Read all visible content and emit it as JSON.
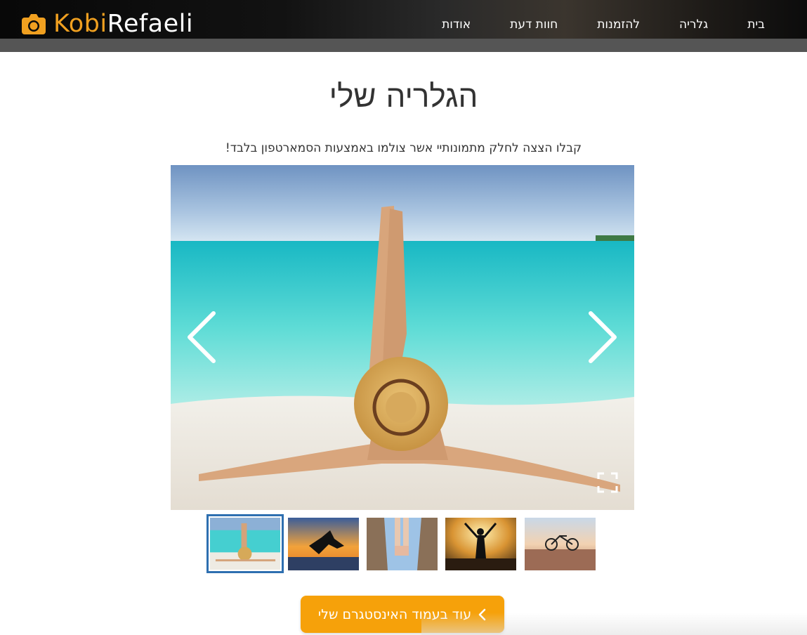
{
  "brand": {
    "name_part1": "Kobi",
    "name_part2": "Refaeli",
    "icon": "camera-icon"
  },
  "nav": {
    "items": [
      {
        "label": "בית"
      },
      {
        "label": "גלריה"
      },
      {
        "label": "להזמנות"
      },
      {
        "label": "חוות דעת"
      },
      {
        "label": "אודות"
      }
    ]
  },
  "gallery": {
    "title": "הגלריה שלי",
    "subtitle": "קבלו הצצה לחלק מתמונותיי אשר צולמו באמצעות הסמארטפון בלבד!",
    "prev_icon": "chevron-left-icon",
    "next_icon": "chevron-right-icon",
    "fullscreen_icon": "fullscreen-icon",
    "thumbnails_count": 5,
    "active_thumbnail_index": 0
  },
  "cta": {
    "label": "עוד בעמוד האינסטגרם שלי",
    "icon": "chevron-left-icon"
  },
  "colors": {
    "accent": "#f6a10a",
    "brand_orange": "#f0a020",
    "thumb_border": "#2e6fb0"
  }
}
